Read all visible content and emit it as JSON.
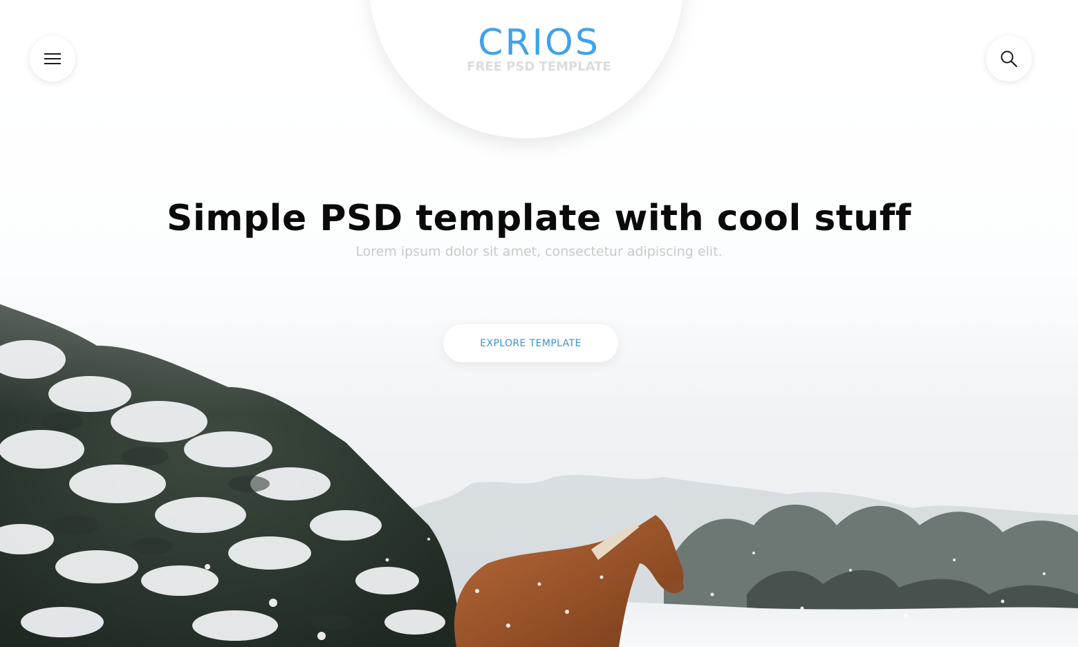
{
  "brand": {
    "name": "CRIOS",
    "tagline": "FREE PSD TEMPLATE",
    "accent_color": "#3fa2e8"
  },
  "header": {
    "menu_icon": "hamburger-menu-icon",
    "search_icon": "search-icon"
  },
  "hero": {
    "title": "Simple PSD template with cool stuff",
    "subtitle": "Lorem ipsum dolor sit amet, consectetur adipiscing elit.",
    "cta_label": "EXPLORE TEMPLATE",
    "background": "snowy-landscape-with-horse"
  }
}
